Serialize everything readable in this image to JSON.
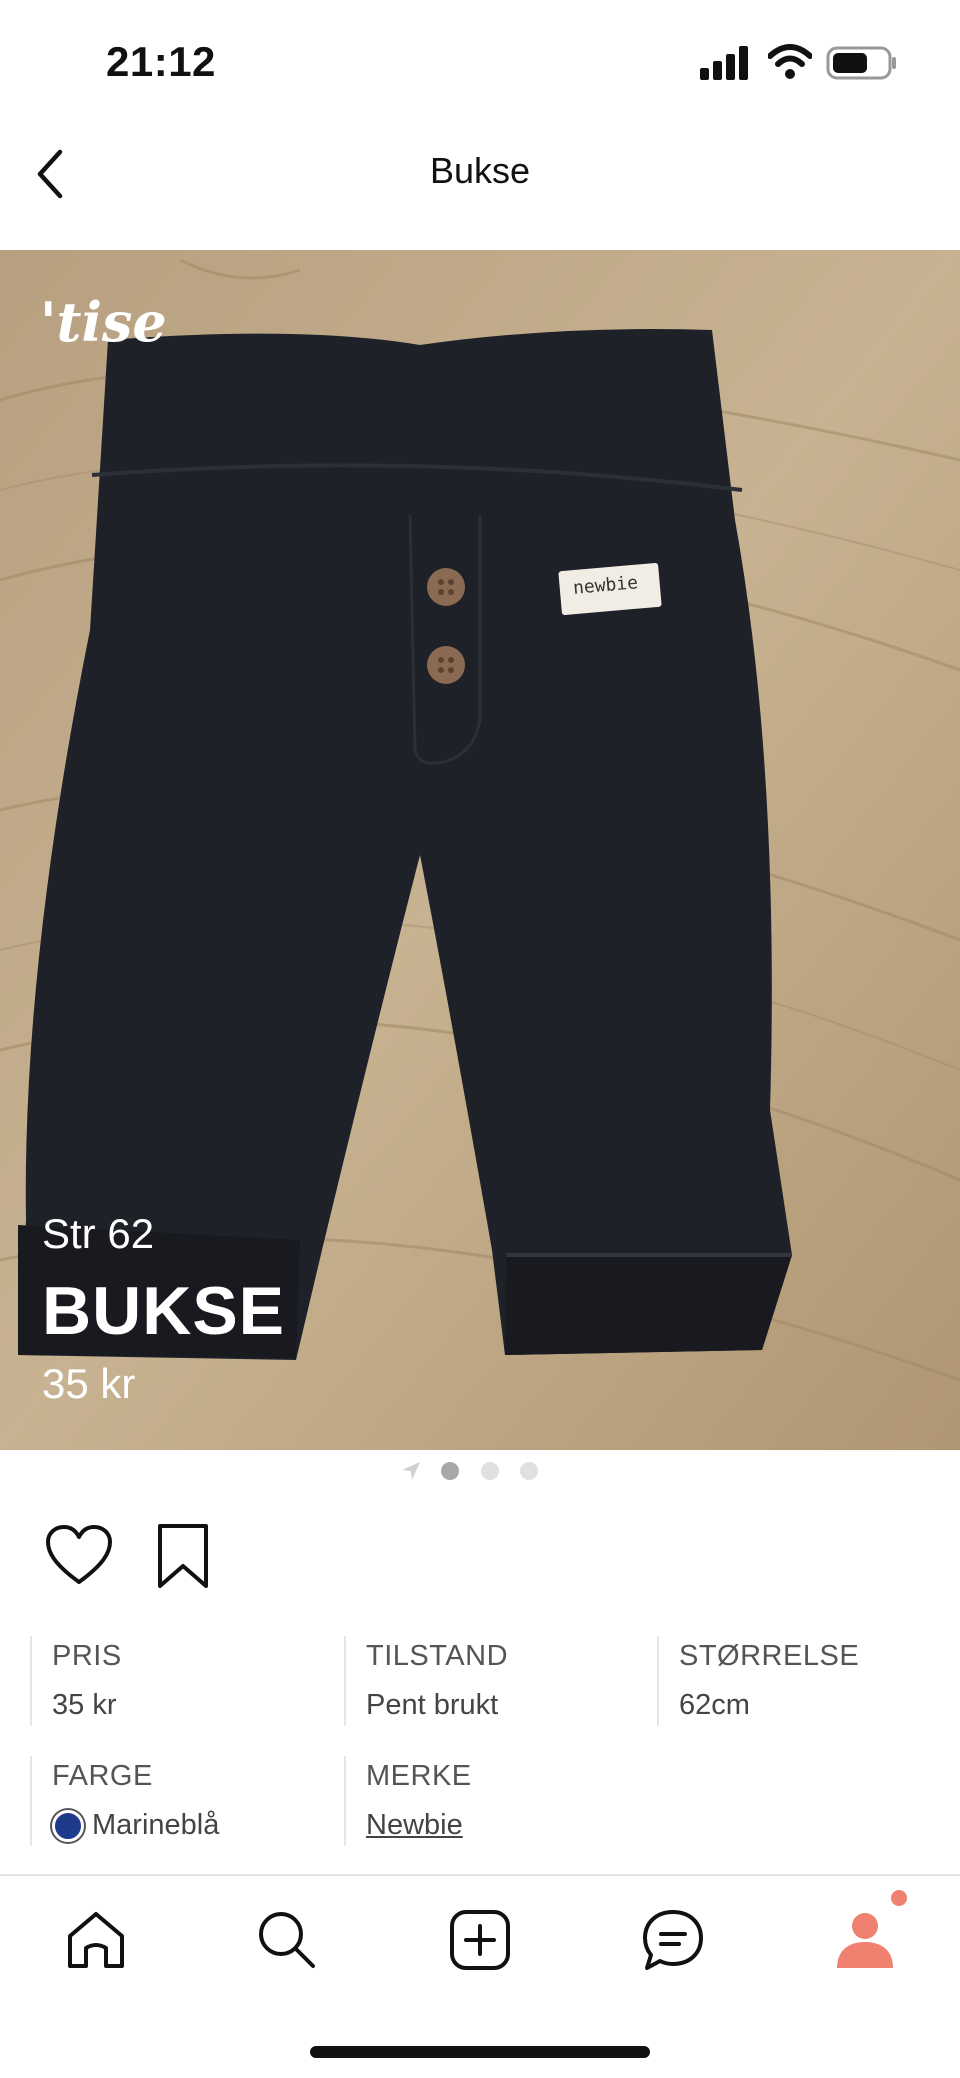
{
  "status_bar": {
    "time": "21:12"
  },
  "nav": {
    "title": "Bukse"
  },
  "listing": {
    "logo_text": "'tise",
    "overlay_size": "Str 62",
    "overlay_title": "BUKSE",
    "overlay_price": "35 kr",
    "label_text": "newbie"
  },
  "pager": {
    "count": 3,
    "active_index": 0
  },
  "attributes": {
    "price": {
      "label": "PRIS",
      "value": "35 kr"
    },
    "condition": {
      "label": "TILSTAND",
      "value": "Pent brukt"
    },
    "size": {
      "label": "STØRRELSE",
      "value": "62cm"
    },
    "color": {
      "label": "FARGE",
      "value": "Marineblå",
      "swatch": "#1e3a8a"
    },
    "brand": {
      "label": "MERKE",
      "value": "Newbie"
    }
  },
  "tabbar": {
    "items": [
      "home-icon",
      "search-icon",
      "add-icon",
      "chat-icon",
      "profile-icon"
    ],
    "accent": "#f08070"
  }
}
